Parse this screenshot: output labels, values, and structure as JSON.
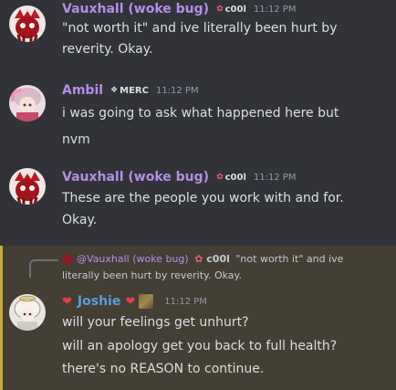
{
  "colors": {
    "background": "#313338",
    "vauxhall_name": "#b58de6",
    "ambil_name": "#b58de6",
    "joshie_name": "#5b9dd9",
    "highlight": "#433f34",
    "time": "#949ba4"
  },
  "messages": [
    {
      "author": "Vauxhall (woke bug)",
      "tag": "c00l",
      "time": "11:12 PM",
      "lines": [
        "\"not worth it\" and ive literally been hurt by",
        "reverity. Okay."
      ]
    },
    {
      "author": "Ambil",
      "tag": "MERC",
      "time": "11:12 PM",
      "lines": [
        "i was going to ask what happened here but",
        "nvm"
      ]
    },
    {
      "author": "Vauxhall (woke bug)",
      "tag": "c00l",
      "time": "11:12 PM",
      "lines": [
        "These are the people you work with and for.",
        "Okay."
      ]
    },
    {
      "reply": {
        "author": "@Vauxhall (woke bug)",
        "tag": "c00l",
        "text1": "\"not worth it\" and ive",
        "text2": "literally been hurt by reverity. Okay."
      },
      "author": "Joshie",
      "time": "11:12 PM",
      "lines": [
        "will your feelings get unhurt?",
        "will an apology get you back to full health?",
        "there's no REASON to continue."
      ]
    }
  ],
  "icons": {
    "tag_glyph": "✿",
    "merc_glyph": "❖",
    "heart": "❤"
  }
}
